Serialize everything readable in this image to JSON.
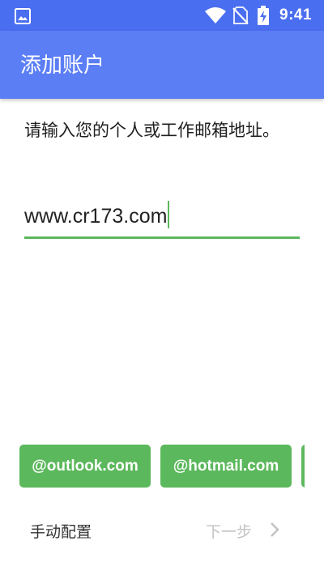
{
  "status_bar": {
    "time": "9:41",
    "icons": [
      "image-icon",
      "wifi-icon",
      "no-sim-icon",
      "battery-charging-icon"
    ]
  },
  "app_bar": {
    "title": "添加账户"
  },
  "content": {
    "prompt": "请输入您的个人或工作邮箱地址。",
    "email_value": "www.cr173.com"
  },
  "suggestions": [
    {
      "label": "@outlook.com"
    },
    {
      "label": "@hotmail.com"
    },
    {
      "label": ""
    }
  ],
  "footer": {
    "manual_label": "手动配置",
    "next_label": "下一步"
  },
  "colors": {
    "status_bar": "#4a6ef0",
    "app_bar": "#5b7ef5",
    "accent_green": "#5cb85c",
    "disabled_text": "#c2c2c2"
  }
}
